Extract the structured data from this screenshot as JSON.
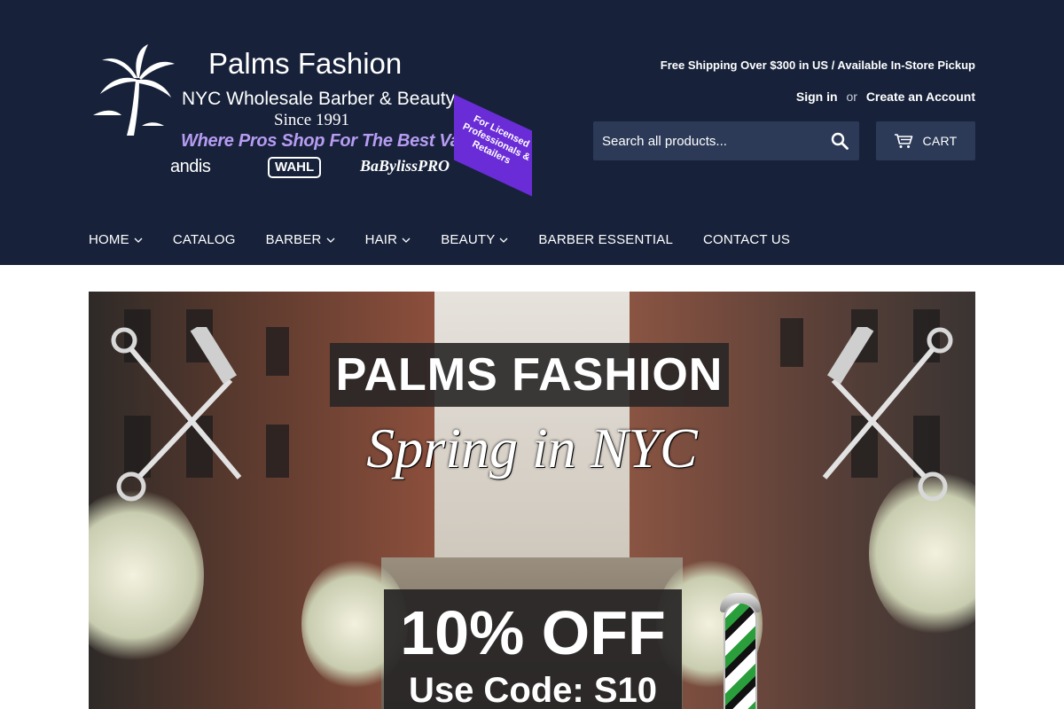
{
  "logo": {
    "title": "Palms Fashion",
    "subtitle": "NYC Wholesale Barber & Beauty",
    "since": "Since 1991",
    "tagline": "Where Pros Shop For The Best Value",
    "badge": "For Licensed Professionals & Retailers",
    "brands": [
      "andis",
      "WAHL",
      "BaBylissPRO"
    ]
  },
  "header": {
    "promo": "Free Shipping Over $300 in US / Available In-Store Pickup",
    "sign_in": "Sign in",
    "or": "or",
    "create_account": "Create an Account",
    "search_placeholder": "Search all products...",
    "cart_label": "CART"
  },
  "nav": {
    "items": [
      {
        "label": "HOME",
        "dropdown": true
      },
      {
        "label": "CATALOG",
        "dropdown": false
      },
      {
        "label": "BARBER",
        "dropdown": true
      },
      {
        "label": "HAIR",
        "dropdown": true
      },
      {
        "label": "BEAUTY",
        "dropdown": true
      },
      {
        "label": "BARBER ESSENTIAL",
        "dropdown": false
      },
      {
        "label": "CONTACT US",
        "dropdown": false
      }
    ]
  },
  "banner": {
    "title": "PALMS FASHION",
    "script": "Spring in NYC",
    "discount": "10% OFF",
    "code": "Use Code: S10"
  },
  "colors": {
    "header_bg": "#17223a",
    "control_bg": "#2c3a58",
    "badge": "#6a2cd6",
    "tagline": "#b79cf2"
  }
}
